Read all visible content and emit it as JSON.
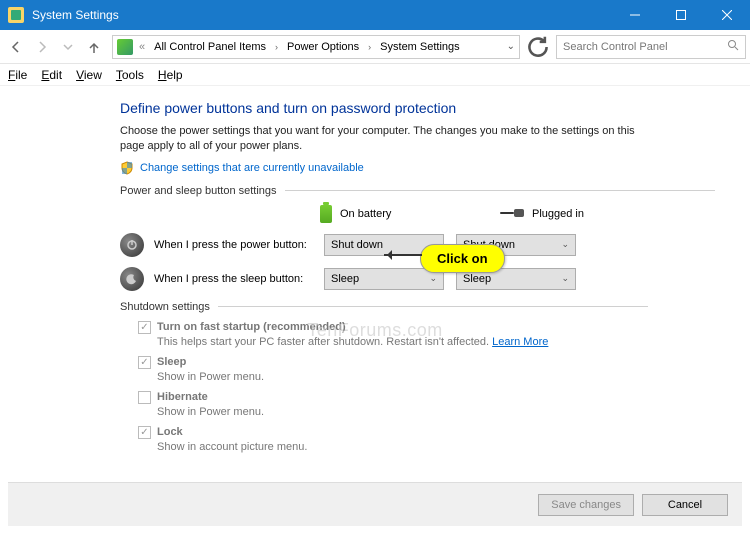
{
  "titlebar": {
    "title": "System Settings"
  },
  "breadcrumb": {
    "prefix": "«",
    "items": [
      "All Control Panel Items",
      "Power Options",
      "System Settings"
    ]
  },
  "search": {
    "placeholder": "Search Control Panel"
  },
  "menu": {
    "file": "File",
    "edit": "Edit",
    "view": "View",
    "tools": "Tools",
    "help": "Help"
  },
  "page": {
    "heading": "Define power buttons and turn on password protection",
    "desc": "Choose the power settings that you want for your computer. The changes you make to the settings on this page apply to all of your power plans.",
    "change_link": "Change settings that are currently unavailable"
  },
  "callout": {
    "text": "Click on"
  },
  "group_buttons": {
    "header": "Power and sleep button settings",
    "col_battery": "On battery",
    "col_plugged": "Plugged in",
    "rows": [
      {
        "label": "When I press the power button:",
        "battery": "Shut down",
        "plugged": "Shut down"
      },
      {
        "label": "When I press the sleep button:",
        "battery": "Sleep",
        "plugged": "Sleep"
      }
    ]
  },
  "group_shutdown": {
    "header": "Shutdown settings",
    "options": [
      {
        "checked": true,
        "label": "Turn on fast startup (recommended)",
        "bold": true,
        "desc": "This helps start your PC faster after shutdown. Restart isn't affected.",
        "learn_more": "Learn More"
      },
      {
        "checked": true,
        "label": "Sleep",
        "bold": true,
        "desc": "Show in Power menu."
      },
      {
        "checked": false,
        "label": "Hibernate",
        "bold": true,
        "desc": "Show in Power menu."
      },
      {
        "checked": true,
        "label": "Lock",
        "bold": true,
        "desc": "Show in account picture menu."
      }
    ]
  },
  "footer": {
    "save": "Save changes",
    "cancel": "Cancel"
  },
  "watermark": "TenForums.com"
}
